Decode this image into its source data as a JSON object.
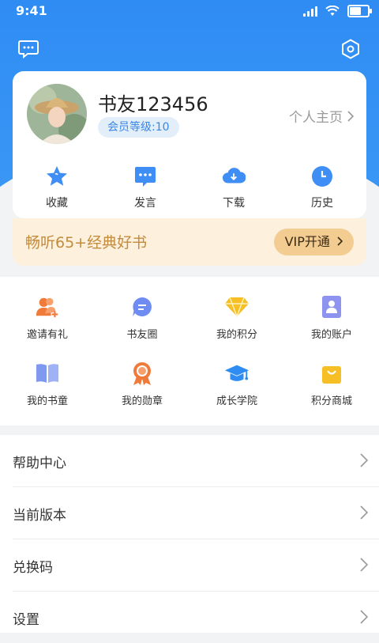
{
  "status_bar": {
    "time": "9:41"
  },
  "profile": {
    "nickname": "书友123456",
    "level": "会员等级:10",
    "homepage_label": "个人主页"
  },
  "quick_actions": [
    {
      "label": "收藏",
      "icon": "star-icon"
    },
    {
      "label": "发言",
      "icon": "comment-icon"
    },
    {
      "label": "下载",
      "icon": "cloud-download-icon"
    },
    {
      "label": "历史",
      "icon": "clock-icon"
    }
  ],
  "vip": {
    "promo_text": "畅听65+经典好书",
    "button_label": "VIP开通"
  },
  "grid_items": [
    {
      "label": "邀请有礼",
      "icon": "invite-users-icon"
    },
    {
      "label": "书友圈",
      "icon": "chat-bubble-icon"
    },
    {
      "label": "我的积分",
      "icon": "diamond-icon"
    },
    {
      "label": "我的账户",
      "icon": "account-icon"
    },
    {
      "label": "我的书童",
      "icon": "book-icon"
    },
    {
      "label": "我的勋章",
      "icon": "medal-icon"
    },
    {
      "label": "成长学院",
      "icon": "graduation-cap-icon"
    },
    {
      "label": "积分商城",
      "icon": "shopping-bag-icon"
    }
  ],
  "menu": [
    {
      "label": "帮助中心"
    },
    {
      "label": "当前版本"
    },
    {
      "label": "兑换码"
    },
    {
      "label": "设置"
    }
  ],
  "colors": {
    "header_blue": "#2f8cf3",
    "vip_gold": "#c38b3c",
    "vip_button": "#f2cc90",
    "badge_bg": "#e3eefb",
    "badge_text": "#3a86e6"
  }
}
